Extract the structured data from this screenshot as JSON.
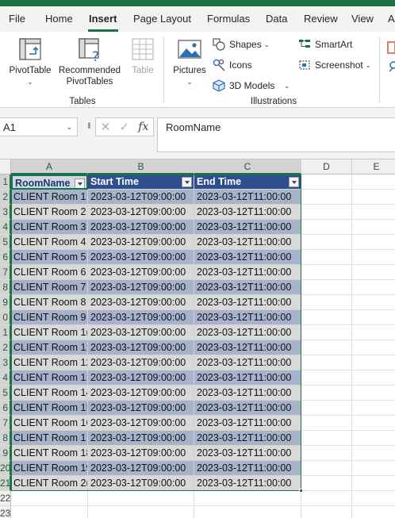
{
  "menu": {
    "tabs": [
      "File",
      "Home",
      "Insert",
      "Page Layout",
      "Formulas",
      "Data",
      "Review",
      "View",
      "A"
    ],
    "active": "Insert"
  },
  "ribbon": {
    "tables": {
      "label": "Tables",
      "pivot_table": "PivotTable",
      "recommended_line1": "Recommended",
      "recommended_line2": "PivotTables",
      "table": "Table"
    },
    "illustrations": {
      "label": "Illustrations",
      "pictures": "Pictures",
      "shapes": "Shapes",
      "icons": "Icons",
      "models_3d": "3D Models",
      "smartart": "SmartArt",
      "screenshot": "Screenshot"
    }
  },
  "formula_bar": {
    "name_box": "A1",
    "cancel": "✕",
    "enter": "✓",
    "fx": "fx",
    "content": "RoomName"
  },
  "sheet": {
    "columns": [
      "A",
      "B",
      "C",
      "D",
      "E"
    ],
    "header_row": [
      "RoomName",
      "Start Time",
      "End Time"
    ],
    "row_numbers": [
      "1",
      "2",
      "3",
      "4",
      "5",
      "6",
      "7",
      "8",
      "9",
      "0",
      "1",
      "2",
      "3",
      "4",
      "5",
      "6",
      "7",
      "8",
      "9",
      "20",
      "21",
      "22",
      "23"
    ],
    "rows": [
      [
        "CLIENT Room 1",
        "2023-03-12T09:00:00",
        "2023-03-12T11:00:00"
      ],
      [
        "CLIENT Room 2",
        "2023-03-12T09:00:00",
        "2023-03-12T11:00:00"
      ],
      [
        "CLIENT Room 3",
        "2023-03-12T09:00:00",
        "2023-03-12T11:00:00"
      ],
      [
        "CLIENT Room 4",
        "2023-03-12T09:00:00",
        "2023-03-12T11:00:00"
      ],
      [
        "CLIENT Room 5",
        "2023-03-12T09:00:00",
        "2023-03-12T11:00:00"
      ],
      [
        "CLIENT Room 6",
        "2023-03-12T09:00:00",
        "2023-03-12T11:00:00"
      ],
      [
        "CLIENT Room 7",
        "2023-03-12T09:00:00",
        "2023-03-12T11:00:00"
      ],
      [
        "CLIENT Room 8",
        "2023-03-12T09:00:00",
        "2023-03-12T11:00:00"
      ],
      [
        "CLIENT Room 9",
        "2023-03-12T09:00:00",
        "2023-03-12T11:00:00"
      ],
      [
        "CLIENT Room 1(",
        "2023-03-12T09:00:00",
        "2023-03-12T11:00:00"
      ],
      [
        "CLIENT Room 1:",
        "2023-03-12T09:00:00",
        "2023-03-12T11:00:00"
      ],
      [
        "CLIENT Room 12",
        "2023-03-12T09:00:00",
        "2023-03-12T11:00:00"
      ],
      [
        "CLIENT Room 1:",
        "2023-03-12T09:00:00",
        "2023-03-12T11:00:00"
      ],
      [
        "CLIENT Room 14",
        "2023-03-12T09:00:00",
        "2023-03-12T11:00:00"
      ],
      [
        "CLIENT Room 1!",
        "2023-03-12T09:00:00",
        "2023-03-12T11:00:00"
      ],
      [
        "CLIENT Room 16",
        "2023-03-12T09:00:00",
        "2023-03-12T11:00:00"
      ],
      [
        "CLIENT Room 1",
        "2023-03-12T09:00:00",
        "2023-03-12T11:00:00"
      ],
      [
        "CLIENT Room 18",
        "2023-03-12T09:00:00",
        "2023-03-12T11:00:00"
      ],
      [
        "CLIENT Room 19",
        "2023-03-12T09:00:00",
        "2023-03-12T11:00:00"
      ],
      [
        "CLIENT Room 2(",
        "2023-03-12T09:00:00",
        "2023-03-12T11:00:00"
      ]
    ]
  }
}
